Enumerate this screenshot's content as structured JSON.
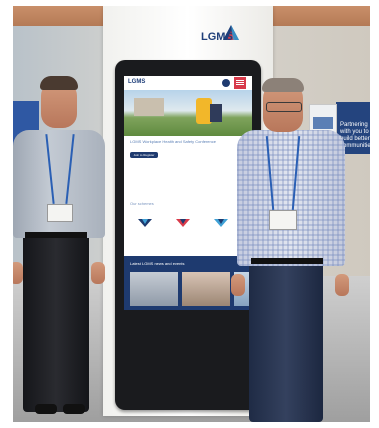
{
  "booth": {
    "logo": {
      "text": "LGMS",
      "mark": "triangle-logo-icon"
    },
    "side_banner": {
      "lines": [
        "Partnering",
        "with you to",
        "build better",
        "communities"
      ]
    }
  },
  "kiosk_screen": {
    "header_logo": "LGMS",
    "hero_text": "LGMS Workplace Health and Safety Conference",
    "hero_button": "Join to Register",
    "schemes_title": "Our schemes",
    "news_title": "Latest LGMS news and events",
    "colors": {
      "brand_navy": "#1e3a6f",
      "brand_red": "#d83a4a"
    }
  }
}
